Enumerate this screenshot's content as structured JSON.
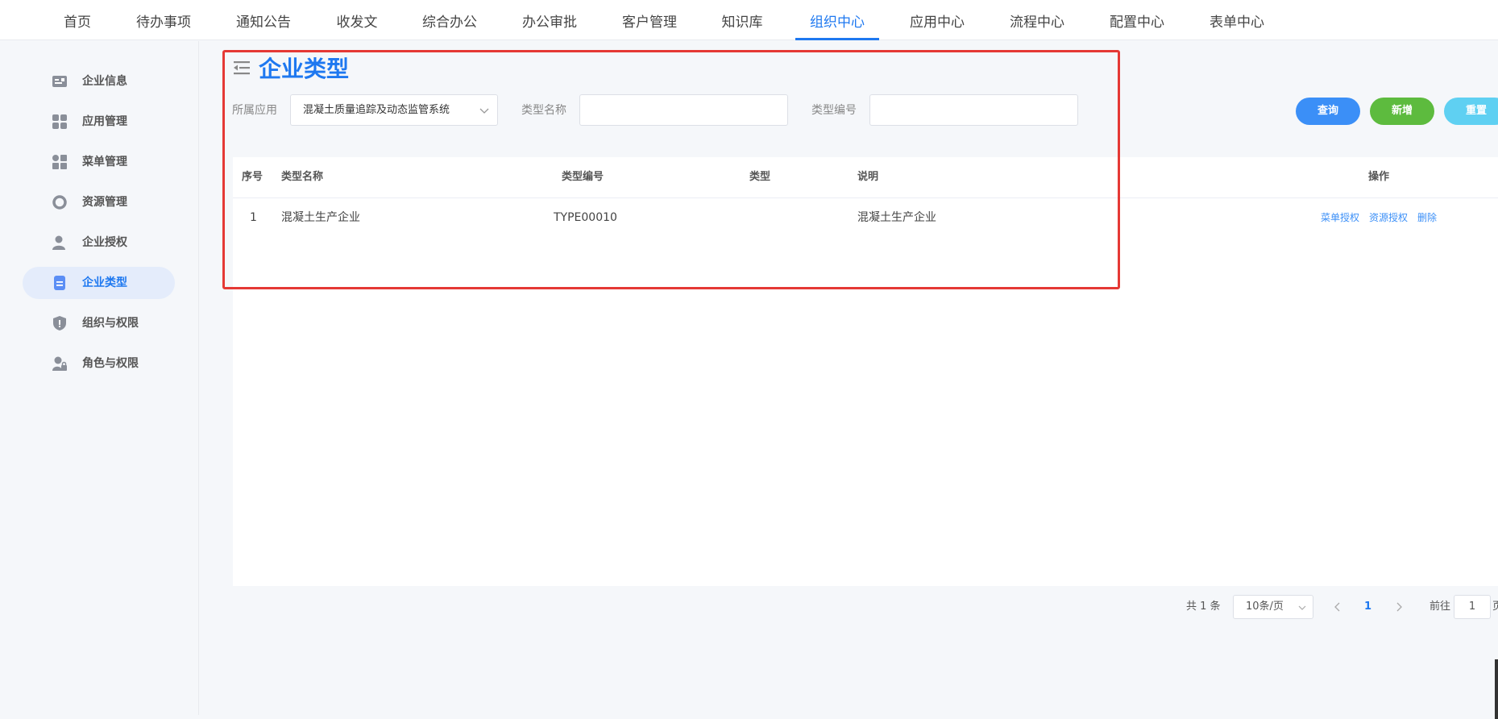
{
  "nav": {
    "items": [
      "首页",
      "待办事项",
      "通知公告",
      "收发文",
      "综合办公",
      "办公审批",
      "客户管理",
      "知识库",
      "组织中心",
      "应用中心",
      "流程中心",
      "配置中心",
      "表单中心"
    ],
    "active": "组织中心",
    "accent_color": "#1e78f0"
  },
  "sidebar": {
    "items": [
      {
        "label": "企业信息",
        "icon": "id-card-icon"
      },
      {
        "label": "应用管理",
        "icon": "grid-icon"
      },
      {
        "label": "菜单管理",
        "icon": "menu-grid-icon"
      },
      {
        "label": "资源管理",
        "icon": "ring-icon"
      },
      {
        "label": "企业授权",
        "icon": "user-icon"
      },
      {
        "label": "企业类型",
        "icon": "document-icon"
      },
      {
        "label": "组织与权限",
        "icon": "shield-icon"
      },
      {
        "label": "角色与权限",
        "icon": "user-lock-icon"
      }
    ],
    "active": "企业类型"
  },
  "main": {
    "title": "企业类型",
    "filters": {
      "app_label": "所属应用",
      "app_value": "混凝土质量追踪及动态监管系统",
      "type_name_label": "类型名称",
      "type_name_value": "",
      "type_code_label": "类型编号",
      "type_code_value": ""
    },
    "buttons": {
      "query": "查询",
      "add": "新增",
      "reset": "重置"
    },
    "table": {
      "headers": {
        "index": "序号",
        "name": "类型名称",
        "code": "类型编号",
        "type": "类型",
        "desc": "说明",
        "ops": "操作"
      },
      "rows": [
        {
          "index": "1",
          "name": "混凝土生产企业",
          "code": "TYPE00010",
          "type": "",
          "desc": "混凝土生产企业",
          "ops": [
            "菜单授权",
            "资源授权",
            "删除"
          ]
        }
      ]
    },
    "pagination": {
      "total": "共 1 条",
      "page_size": "10条/页",
      "current_page": "1",
      "goto_label": "前往",
      "goto_value": "1",
      "goto_suffix": "页"
    }
  },
  "colors": {
    "query": "#3b8ff7",
    "add": "#5dbb3e",
    "reset": "#5fd0f2",
    "highlight": "#e53935"
  }
}
